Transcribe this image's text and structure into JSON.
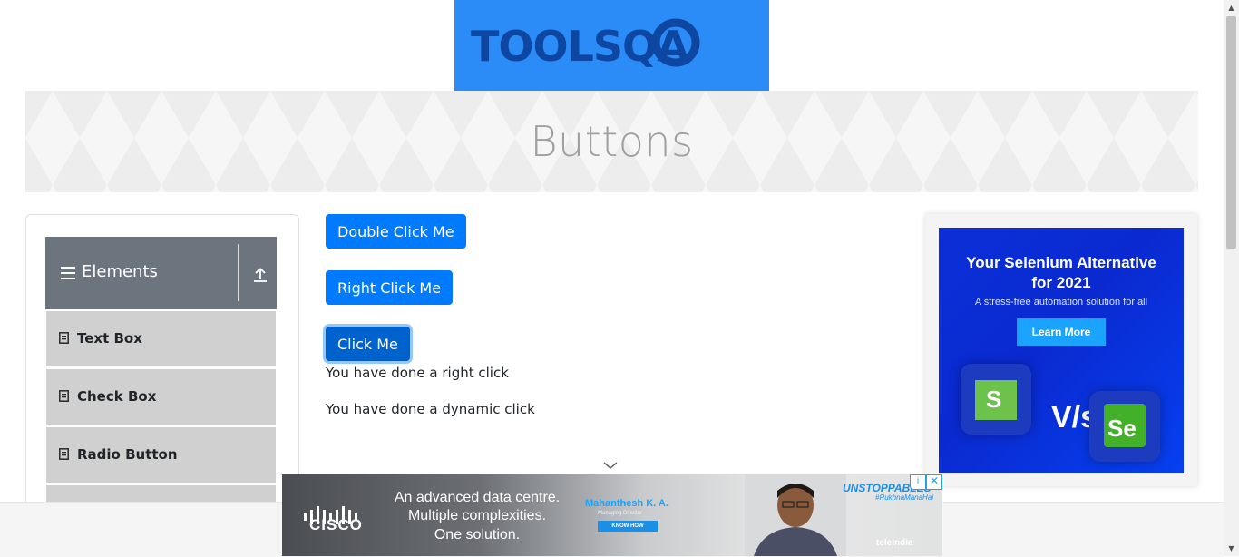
{
  "header": {
    "logo_text": "TOOLSQA"
  },
  "banner": {
    "title": "Buttons"
  },
  "sidebar": {
    "group_title": "Elements",
    "items": [
      {
        "label": "Text Box"
      },
      {
        "label": "Check Box"
      },
      {
        "label": "Radio Button"
      }
    ]
  },
  "main": {
    "buttons": {
      "double_click": "Double Click Me",
      "right_click": "Right Click Me",
      "click": "Click Me"
    },
    "messages": {
      "right_click": "You have done a right click",
      "dynamic_click": "You have done a dynamic click"
    }
  },
  "right_ad": {
    "headline_line1": "Your Selenium Alternative",
    "headline_line2": "for 2021",
    "subtitle": "A stress-free automation solution for all",
    "cta": "Learn More",
    "vs_text": "V/s",
    "se_text": "Se",
    "s_text": "S"
  },
  "bottom_ad": {
    "brand": "CISCO",
    "line1": "An advanced data centre.",
    "line2": "Multiple complexities.",
    "line3": "One solution.",
    "person_name": "Mahanthesh K. A.",
    "person_title": "Managing Director",
    "cta": "KNOW HOW",
    "tag_main": "UNSTOPPABLES",
    "tag_sub": "#RukhnaManaHai",
    "sponsor": "teleIndia",
    "adchoices": "i",
    "close": "✕"
  },
  "colors": {
    "primary": "#007bff",
    "group_header": "#6c757d",
    "menu_item": "#d0d0d0",
    "logo_bg": "#2b8cf7",
    "logo_fg": "#0d47a1"
  },
  "icons": [
    "menu-icon",
    "upload-icon",
    "file-icon",
    "chevron-down-icon",
    "adchoices-icon",
    "close-icon"
  ]
}
